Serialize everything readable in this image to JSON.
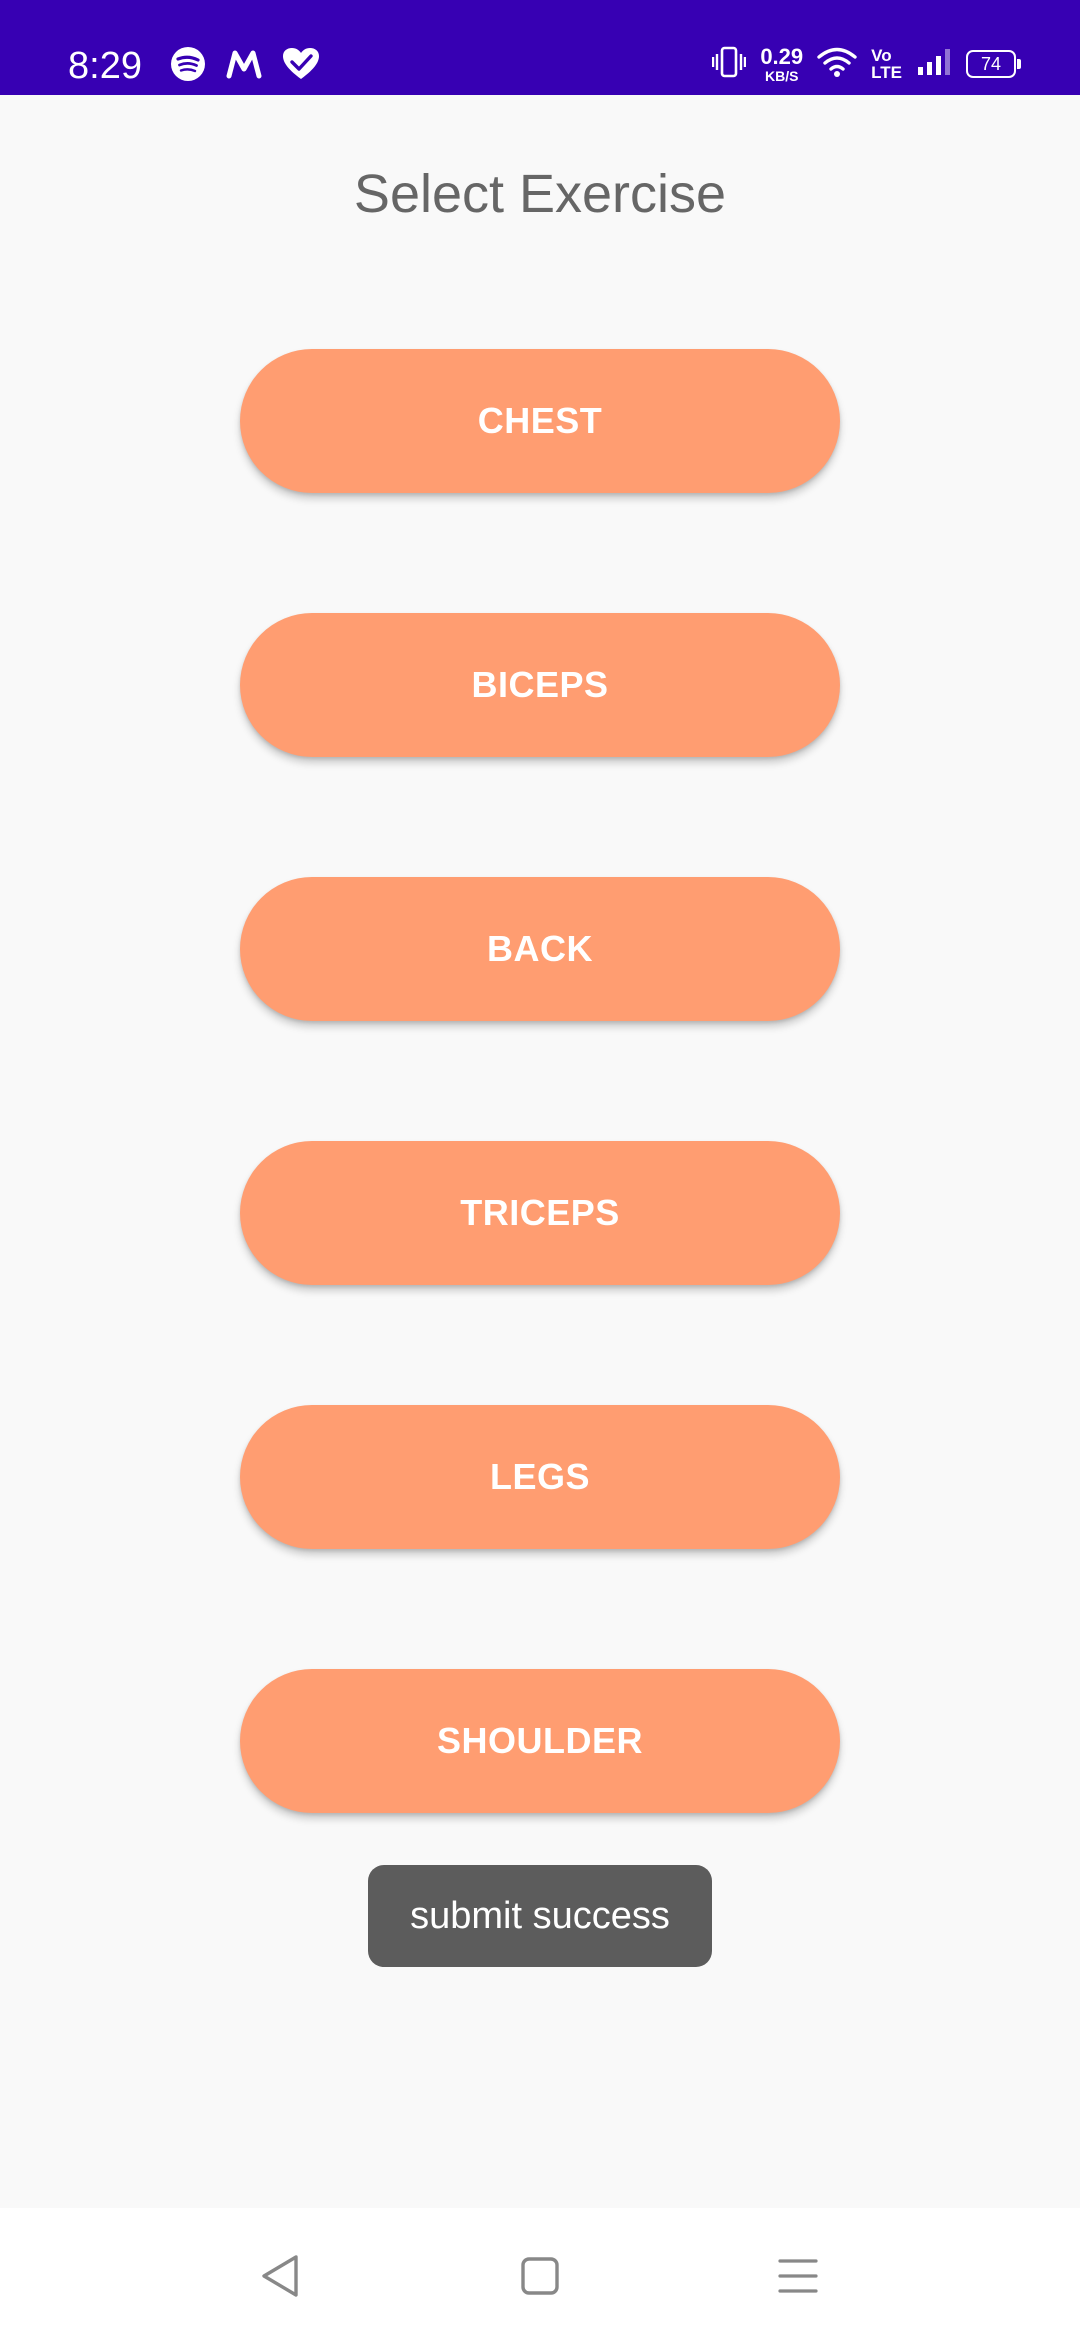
{
  "status_bar": {
    "time": "8:29",
    "net_speed_value": "0.29",
    "net_speed_unit": "KB/S",
    "volte_top": "Vo",
    "volte_bottom": "LTE",
    "battery": "74",
    "icons": [
      "spotify-icon",
      "myntra-icon",
      "health-heart-icon",
      "vibrate-icon",
      "wifi-icon",
      "signal-icon",
      "battery-icon"
    ],
    "background": "#3700b3"
  },
  "page": {
    "title": "Select Exercise"
  },
  "exercises": [
    {
      "label": "CHEST"
    },
    {
      "label": "BICEPS"
    },
    {
      "label": "BACK"
    },
    {
      "label": "TRICEPS"
    },
    {
      "label": "LEGS"
    },
    {
      "label": "SHOULDER"
    }
  ],
  "toast": {
    "message": "submit success"
  },
  "nav_bar": {
    "icons": [
      "back-triangle-icon",
      "home-square-icon",
      "menu-lines-icon"
    ]
  },
  "colors": {
    "accent": "#ff9d71",
    "toast_bg": "#5c5c5c",
    "page_bg": "#f9f9f9"
  }
}
